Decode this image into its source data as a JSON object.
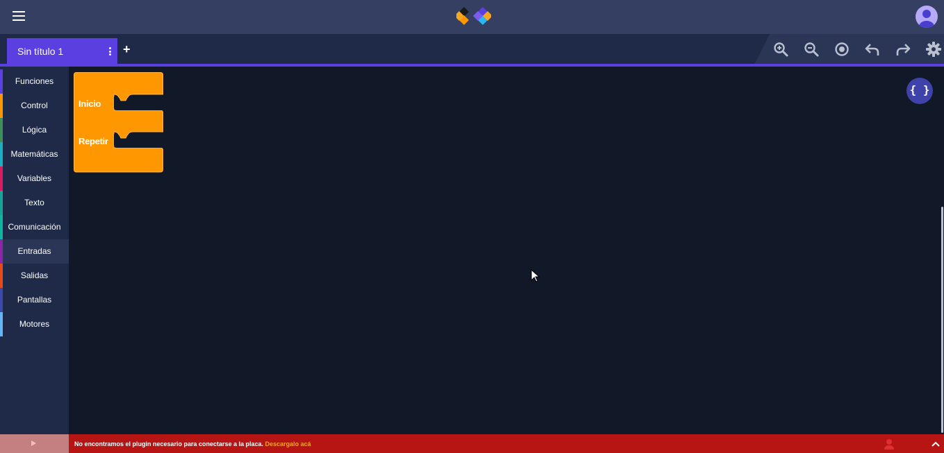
{
  "header": {
    "menu_icon": "hamburger-icon",
    "logo_icon": "diamond-logo-icon",
    "avatar_icon": "user-avatar-icon"
  },
  "tabs": [
    {
      "label": "Sin título 1",
      "active": true
    }
  ],
  "add_tab_label": "+",
  "toolbar": {
    "icons": [
      "zoom-in-icon",
      "zoom-out-icon",
      "center-icon",
      "undo-icon",
      "redo-icon",
      "gear-icon"
    ]
  },
  "sidebar": {
    "categories": [
      {
        "label": "Funciones",
        "color": "#5b3fe0"
      },
      {
        "label": "Control",
        "color": "#ff9800"
      },
      {
        "label": "Lógica",
        "color": "#3e8e5a"
      },
      {
        "label": "Matemáticas",
        "color": "#1db0c2"
      },
      {
        "label": "Variables",
        "color": "#d81b60"
      },
      {
        "label": "Texto",
        "color": "#17a398"
      },
      {
        "label": "Comunicación",
        "color": "#10b5a0"
      },
      {
        "label": "Entradas",
        "color": "#8e24aa"
      },
      {
        "label": "Salidas",
        "color": "#e64a19"
      },
      {
        "label": "Pantallas",
        "color": "#3949ab"
      },
      {
        "label": "Motores",
        "color": "#64b5f6"
      }
    ],
    "active": "Entradas"
  },
  "workspace": {
    "block": {
      "color": "#ff9800",
      "inputs": [
        "Inicio",
        "Repetir"
      ]
    },
    "code_button_label": "{ }"
  },
  "footer": {
    "message": "No encontramos el plugin necesario para conectarse a la placa.",
    "link": "Descargalo acá",
    "background": "#b71414"
  }
}
